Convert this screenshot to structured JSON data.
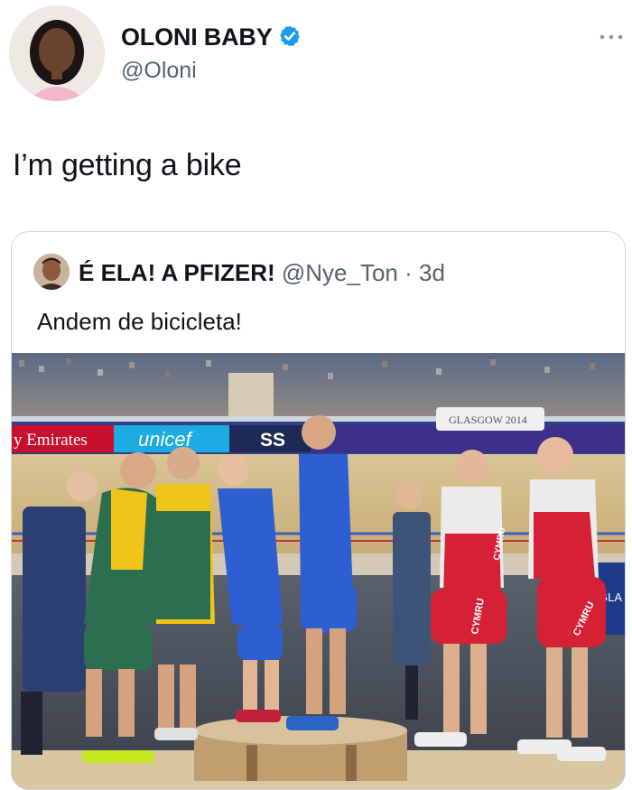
{
  "author": {
    "display_name": "OLONI BABY",
    "handle": "@Oloni",
    "verified": true,
    "avatar": "profile-photo"
  },
  "tweet": {
    "text": "I’m getting a bike"
  },
  "quoted_tweet": {
    "display_name": "É ELA! A PFIZER!",
    "handle": "@Nye_Ton",
    "separator": "·",
    "time": "3d",
    "text": "Andem de bicicleta!",
    "photo": {
      "banner_texts": [
        "y Emirates",
        "unicef",
        "SS",
        "GLASGOW 2014"
      ],
      "jersey_texts": [
        "CYMRU",
        "CYMRU",
        "CYMRU",
        "GLA"
      ]
    }
  },
  "colors": {
    "text_primary": "#0f1419",
    "text_secondary": "#536471",
    "verified_blue": "#1d9bf0",
    "border": "#cfd9de"
  },
  "icons": {
    "verified": "verified-badge-icon",
    "more": "more-options-icon"
  }
}
